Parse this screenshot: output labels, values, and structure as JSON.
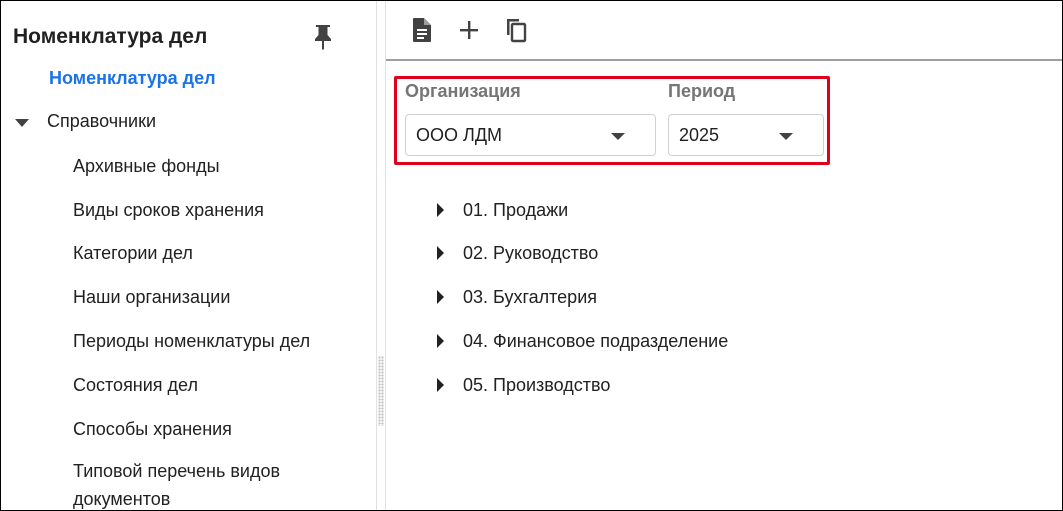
{
  "sidebar": {
    "title": "Номенклатура дел",
    "active_link": "Номенклатура дел",
    "group": "Справочники",
    "items": [
      "Архивные фонды",
      "Виды сроков хранения",
      "Категории дел",
      "Наши организации",
      "Периоды номенклатуры дел",
      "Состояния дел",
      "Способы хранения",
      "Типовой перечень видов документов"
    ]
  },
  "toolbar": {
    "icons": [
      "document-icon",
      "plus-icon",
      "copy-icon"
    ]
  },
  "filters": {
    "organization_label": "Организация",
    "organization_value": "ООО ЛДМ",
    "period_label": "Период",
    "period_value": "2025"
  },
  "tree": [
    "01. Продажи",
    "02. Руководство",
    "03. Бухгалтерия",
    "04. Финансовое подразделение",
    "05. Производство"
  ],
  "colors": {
    "accent": "#1a73e8",
    "highlight": "#e0001b"
  }
}
